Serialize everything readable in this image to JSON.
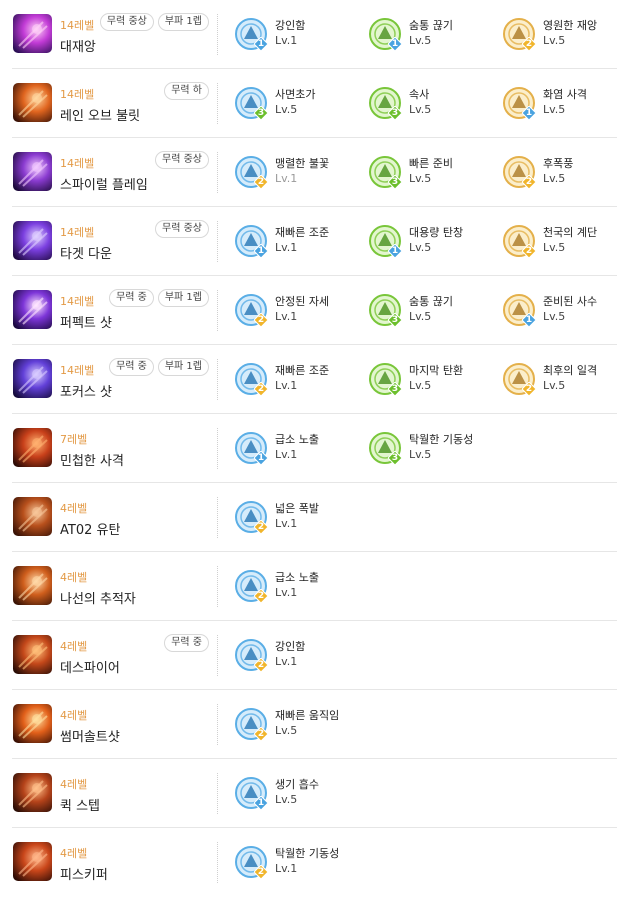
{
  "colors": {
    "level_text": "#e39a46",
    "tier1": "#4aa3e0",
    "tier2": "#f1b52b",
    "tier3": "#6cbf2c"
  },
  "skills": [
    {
      "level": "14레벨",
      "name": "대재앙",
      "badges": [
        "무력 중상",
        "부파 1렙"
      ],
      "icon": "catastrophe-skill-icon",
      "palette": [
        "#2b0f55",
        "#c23bd6",
        "#ffd1f7"
      ],
      "tripods": [
        {
          "name": "강인함",
          "lv": "Lv.1",
          "tier": "1",
          "icon": "person-shield-icon",
          "color": "blue"
        },
        {
          "name": "숨통 끊기",
          "lv": "Lv.5",
          "tier": "1",
          "icon": "gun-icon",
          "color": "green"
        },
        {
          "name": "영원한 재앙",
          "lv": "Lv.5",
          "tier": "2",
          "icon": "sun-burst-icon",
          "color": "gold"
        }
      ]
    },
    {
      "level": "14레벨",
      "name": "레인 오브 불릿",
      "badges": [
        "무력 하"
      ],
      "icon": "rain-of-bullets-skill-icon",
      "palette": [
        "#3a1206",
        "#e0651f",
        "#ffd7a0"
      ],
      "tripods": [
        {
          "name": "사면초가",
          "lv": "Lv.5",
          "tier": "3",
          "icon": "arrows-up-icon",
          "color": "blue"
        },
        {
          "name": "속사",
          "lv": "Lv.5",
          "tier": "3",
          "icon": "stopwatch-icon",
          "color": "green"
        },
        {
          "name": "화염 사격",
          "lv": "Lv.5",
          "tier": "1",
          "icon": "flame-icon",
          "color": "gold"
        }
      ]
    },
    {
      "level": "14레벨",
      "name": "스파이럴 플레임",
      "badges": [
        "무력 중상"
      ],
      "icon": "spiral-flame-skill-icon",
      "palette": [
        "#1c0a3a",
        "#8a3bd0",
        "#f2c9ff"
      ],
      "tripods": [
        {
          "name": "맹렬한 불꽃",
          "lv": "Lv.1",
          "tier": "2",
          "icon": "fire-orb-icon",
          "color": "blue",
          "dim": true
        },
        {
          "name": "빠른 준비",
          "lv": "Lv.5",
          "tier": "3",
          "icon": "gears-icon",
          "color": "green"
        },
        {
          "name": "후폭풍",
          "lv": "Lv.5",
          "tier": "2",
          "icon": "sun-burst-icon",
          "color": "gold"
        }
      ]
    },
    {
      "level": "14레벨",
      "name": "타겟 다운",
      "badges": [
        "무력 중상"
      ],
      "icon": "target-down-skill-icon",
      "palette": [
        "#200a44",
        "#7b3fe0",
        "#e0d0ff"
      ],
      "tripods": [
        {
          "name": "재빠른 조준",
          "lv": "Lv.1",
          "tier": "1",
          "icon": "sword-figure-icon",
          "color": "blue"
        },
        {
          "name": "대용량 탄창",
          "lv": "Lv.5",
          "tier": "1",
          "icon": "gears-icon",
          "color": "green"
        },
        {
          "name": "천국의 계단",
          "lv": "Lv.5",
          "tier": "2",
          "icon": "arrows-up-icon",
          "color": "gold"
        }
      ]
    },
    {
      "level": "14레벨",
      "name": "퍼펙트 샷",
      "badges": [
        "무력 중",
        "부파 1렙"
      ],
      "icon": "perfect-shot-skill-icon",
      "palette": [
        "#1a0840",
        "#7d35d8",
        "#ffe6ff"
      ],
      "tripods": [
        {
          "name": "안정된 자세",
          "lv": "Lv.1",
          "tier": "2",
          "icon": "person-shield-icon",
          "color": "blue"
        },
        {
          "name": "숨통 끊기",
          "lv": "Lv.5",
          "tier": "3",
          "icon": "gun-icon",
          "color": "green"
        },
        {
          "name": "준비된 사수",
          "lv": "Lv.5",
          "tier": "1",
          "icon": "sword-figure-icon",
          "color": "gold"
        }
      ]
    },
    {
      "level": "14레벨",
      "name": "포커스 샷",
      "badges": [
        "무력 중",
        "부파 1렙"
      ],
      "icon": "focus-shot-skill-icon",
      "palette": [
        "#150a3c",
        "#6240d8",
        "#d9ccff"
      ],
      "tripods": [
        {
          "name": "재빠른 조준",
          "lv": "Lv.1",
          "tier": "2",
          "icon": "sword-figure-icon",
          "color": "blue"
        },
        {
          "name": "마지막 탄환",
          "lv": "Lv.5",
          "tier": "3",
          "icon": "bullets-icon",
          "color": "green"
        },
        {
          "name": "최후의 일격",
          "lv": "Lv.5",
          "tier": "2",
          "icon": "crosshair-icon",
          "color": "gold"
        }
      ]
    },
    {
      "level": "7레벨",
      "name": "민첩한 사격",
      "badges": [],
      "icon": "agile-shot-skill-icon",
      "palette": [
        "#2e0b05",
        "#c8401a",
        "#ffb070"
      ],
      "tripods": [
        {
          "name": "급소 노출",
          "lv": "Lv.1",
          "tier": "1",
          "icon": "arrows-up-icon",
          "color": "blue"
        },
        {
          "name": "탁월한 기동성",
          "lv": "Lv.5",
          "tier": "3",
          "icon": "runner-icon",
          "color": "green"
        }
      ]
    },
    {
      "level": "4레벨",
      "name": "AT02 유탄",
      "badges": [],
      "icon": "grenade-skill-icon",
      "palette": [
        "#3a1306",
        "#b8501c",
        "#f7c79a"
      ],
      "tripods": [
        {
          "name": "넓은 폭발",
          "lv": "Lv.1",
          "tier": "2",
          "icon": "crosshair-icon",
          "color": "blue"
        }
      ]
    },
    {
      "level": "4레벨",
      "name": "나선의 추적자",
      "badges": [],
      "icon": "spiral-tracker-skill-icon",
      "palette": [
        "#3b1405",
        "#cf5e1c",
        "#ffd9a8"
      ],
      "tripods": [
        {
          "name": "급소 노출",
          "lv": "Lv.1",
          "tier": "2",
          "icon": "arrows-up-icon",
          "color": "blue"
        }
      ]
    },
    {
      "level": "4레벨",
      "name": "데스파이어",
      "badges": [
        "무력 중"
      ],
      "icon": "death-fire-skill-icon",
      "palette": [
        "#2a0d06",
        "#c4481a",
        "#ffbf7a"
      ],
      "tripods": [
        {
          "name": "강인함",
          "lv": "Lv.1",
          "tier": "2",
          "icon": "person-shield-icon",
          "color": "blue"
        }
      ]
    },
    {
      "level": "4레벨",
      "name": "썸머솔트샷",
      "badges": [],
      "icon": "somersault-shot-skill-icon",
      "palette": [
        "#3a1004",
        "#e2601a",
        "#ffe0a0"
      ],
      "tripods": [
        {
          "name": "재빠른 움직임",
          "lv": "Lv.5",
          "tier": "2",
          "icon": "sword-figure-icon",
          "color": "blue"
        }
      ]
    },
    {
      "level": "4레벨",
      "name": "퀵 스텝",
      "badges": [],
      "icon": "quick-step-skill-icon",
      "palette": [
        "#2c0e06",
        "#b5431a",
        "#ffc08a"
      ],
      "tripods": [
        {
          "name": "생기 흡수",
          "lv": "Lv.5",
          "tier": "1",
          "icon": "wind-icon",
          "color": "blue"
        }
      ]
    },
    {
      "level": "4레벨",
      "name": "피스키퍼",
      "badges": [],
      "icon": "peacekeeper-skill-icon",
      "palette": [
        "#2e0c05",
        "#c9461a",
        "#ffb78a"
      ],
      "tripods": [
        {
          "name": "탁월한 기동성",
          "lv": "Lv.1",
          "tier": "2",
          "icon": "runner-icon",
          "color": "blue"
        }
      ]
    }
  ]
}
